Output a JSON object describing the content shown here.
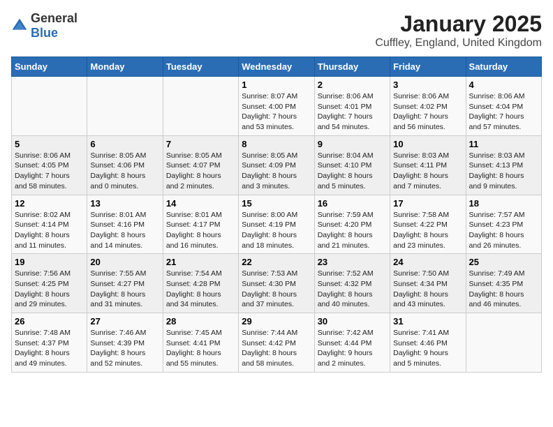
{
  "logo": {
    "general": "General",
    "blue": "Blue"
  },
  "title": "January 2025",
  "subtitle": "Cuffley, England, United Kingdom",
  "days_of_week": [
    "Sunday",
    "Monday",
    "Tuesday",
    "Wednesday",
    "Thursday",
    "Friday",
    "Saturday"
  ],
  "weeks": [
    [
      {
        "day": "",
        "info": ""
      },
      {
        "day": "",
        "info": ""
      },
      {
        "day": "",
        "info": ""
      },
      {
        "day": "1",
        "info": "Sunrise: 8:07 AM\nSunset: 4:00 PM\nDaylight: 7 hours\nand 53 minutes."
      },
      {
        "day": "2",
        "info": "Sunrise: 8:06 AM\nSunset: 4:01 PM\nDaylight: 7 hours\nand 54 minutes."
      },
      {
        "day": "3",
        "info": "Sunrise: 8:06 AM\nSunset: 4:02 PM\nDaylight: 7 hours\nand 56 minutes."
      },
      {
        "day": "4",
        "info": "Sunrise: 8:06 AM\nSunset: 4:04 PM\nDaylight: 7 hours\nand 57 minutes."
      }
    ],
    [
      {
        "day": "5",
        "info": "Sunrise: 8:06 AM\nSunset: 4:05 PM\nDaylight: 7 hours\nand 58 minutes."
      },
      {
        "day": "6",
        "info": "Sunrise: 8:05 AM\nSunset: 4:06 PM\nDaylight: 8 hours\nand 0 minutes."
      },
      {
        "day": "7",
        "info": "Sunrise: 8:05 AM\nSunset: 4:07 PM\nDaylight: 8 hours\nand 2 minutes."
      },
      {
        "day": "8",
        "info": "Sunrise: 8:05 AM\nSunset: 4:09 PM\nDaylight: 8 hours\nand 3 minutes."
      },
      {
        "day": "9",
        "info": "Sunrise: 8:04 AM\nSunset: 4:10 PM\nDaylight: 8 hours\nand 5 minutes."
      },
      {
        "day": "10",
        "info": "Sunrise: 8:03 AM\nSunset: 4:11 PM\nDaylight: 8 hours\nand 7 minutes."
      },
      {
        "day": "11",
        "info": "Sunrise: 8:03 AM\nSunset: 4:13 PM\nDaylight: 8 hours\nand 9 minutes."
      }
    ],
    [
      {
        "day": "12",
        "info": "Sunrise: 8:02 AM\nSunset: 4:14 PM\nDaylight: 8 hours\nand 11 minutes."
      },
      {
        "day": "13",
        "info": "Sunrise: 8:01 AM\nSunset: 4:16 PM\nDaylight: 8 hours\nand 14 minutes."
      },
      {
        "day": "14",
        "info": "Sunrise: 8:01 AM\nSunset: 4:17 PM\nDaylight: 8 hours\nand 16 minutes."
      },
      {
        "day": "15",
        "info": "Sunrise: 8:00 AM\nSunset: 4:19 PM\nDaylight: 8 hours\nand 18 minutes."
      },
      {
        "day": "16",
        "info": "Sunrise: 7:59 AM\nSunset: 4:20 PM\nDaylight: 8 hours\nand 21 minutes."
      },
      {
        "day": "17",
        "info": "Sunrise: 7:58 AM\nSunset: 4:22 PM\nDaylight: 8 hours\nand 23 minutes."
      },
      {
        "day": "18",
        "info": "Sunrise: 7:57 AM\nSunset: 4:23 PM\nDaylight: 8 hours\nand 26 minutes."
      }
    ],
    [
      {
        "day": "19",
        "info": "Sunrise: 7:56 AM\nSunset: 4:25 PM\nDaylight: 8 hours\nand 29 minutes."
      },
      {
        "day": "20",
        "info": "Sunrise: 7:55 AM\nSunset: 4:27 PM\nDaylight: 8 hours\nand 31 minutes."
      },
      {
        "day": "21",
        "info": "Sunrise: 7:54 AM\nSunset: 4:28 PM\nDaylight: 8 hours\nand 34 minutes."
      },
      {
        "day": "22",
        "info": "Sunrise: 7:53 AM\nSunset: 4:30 PM\nDaylight: 8 hours\nand 37 minutes."
      },
      {
        "day": "23",
        "info": "Sunrise: 7:52 AM\nSunset: 4:32 PM\nDaylight: 8 hours\nand 40 minutes."
      },
      {
        "day": "24",
        "info": "Sunrise: 7:50 AM\nSunset: 4:34 PM\nDaylight: 8 hours\nand 43 minutes."
      },
      {
        "day": "25",
        "info": "Sunrise: 7:49 AM\nSunset: 4:35 PM\nDaylight: 8 hours\nand 46 minutes."
      }
    ],
    [
      {
        "day": "26",
        "info": "Sunrise: 7:48 AM\nSunset: 4:37 PM\nDaylight: 8 hours\nand 49 minutes."
      },
      {
        "day": "27",
        "info": "Sunrise: 7:46 AM\nSunset: 4:39 PM\nDaylight: 8 hours\nand 52 minutes."
      },
      {
        "day": "28",
        "info": "Sunrise: 7:45 AM\nSunset: 4:41 PM\nDaylight: 8 hours\nand 55 minutes."
      },
      {
        "day": "29",
        "info": "Sunrise: 7:44 AM\nSunset: 4:42 PM\nDaylight: 8 hours\nand 58 minutes."
      },
      {
        "day": "30",
        "info": "Sunrise: 7:42 AM\nSunset: 4:44 PM\nDaylight: 9 hours\nand 2 minutes."
      },
      {
        "day": "31",
        "info": "Sunrise: 7:41 AM\nSunset: 4:46 PM\nDaylight: 9 hours\nand 5 minutes."
      },
      {
        "day": "",
        "info": ""
      }
    ]
  ]
}
